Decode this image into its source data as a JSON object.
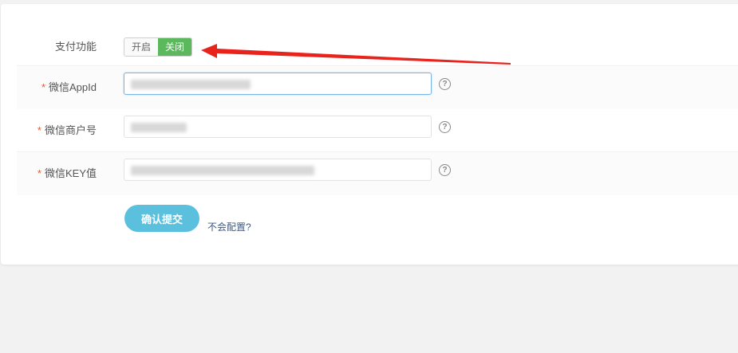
{
  "form": {
    "pay_label": "支付功能",
    "toggle_on": "开启",
    "toggle_off": "关闭",
    "required_mark": "*",
    "appid_label": "微信AppId",
    "mchid_label": "微信商户号",
    "key_label": "微信KEY值",
    "help_glyph": "?",
    "submit_label": "确认提交",
    "help_link": "不会配置?"
  },
  "colors": {
    "toggle_active": "#5cb85c",
    "submit": "#5bc0de",
    "required": "#e4572e",
    "arrow": "#e8231b"
  }
}
